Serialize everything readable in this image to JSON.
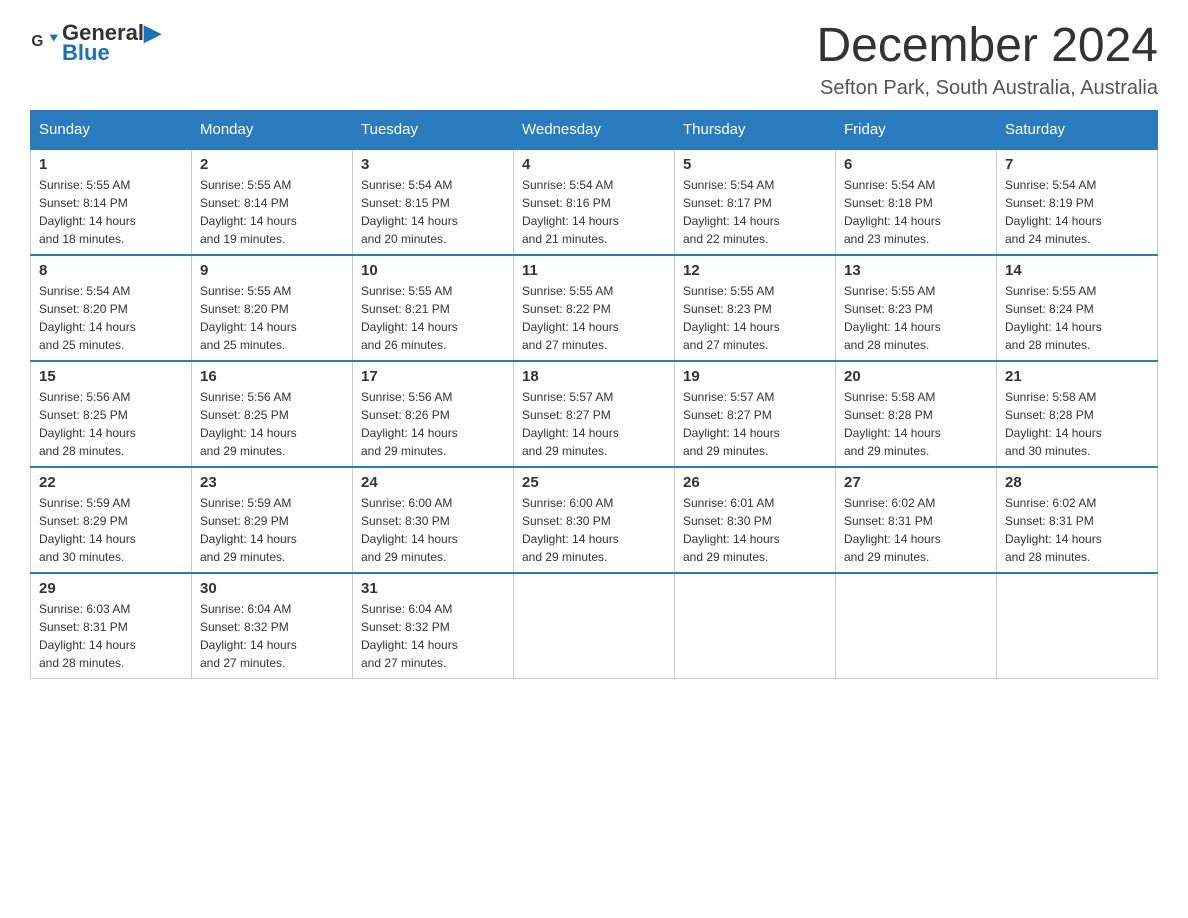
{
  "header": {
    "logo_general": "General",
    "logo_blue": "Blue",
    "month_title": "December 2024",
    "location": "Sefton Park, South Australia, Australia"
  },
  "days_of_week": [
    "Sunday",
    "Monday",
    "Tuesday",
    "Wednesday",
    "Thursday",
    "Friday",
    "Saturday"
  ],
  "weeks": [
    [
      {
        "day": "1",
        "sunrise": "5:55 AM",
        "sunset": "8:14 PM",
        "daylight": "14 hours and 18 minutes."
      },
      {
        "day": "2",
        "sunrise": "5:55 AM",
        "sunset": "8:14 PM",
        "daylight": "14 hours and 19 minutes."
      },
      {
        "day": "3",
        "sunrise": "5:54 AM",
        "sunset": "8:15 PM",
        "daylight": "14 hours and 20 minutes."
      },
      {
        "day": "4",
        "sunrise": "5:54 AM",
        "sunset": "8:16 PM",
        "daylight": "14 hours and 21 minutes."
      },
      {
        "day": "5",
        "sunrise": "5:54 AM",
        "sunset": "8:17 PM",
        "daylight": "14 hours and 22 minutes."
      },
      {
        "day": "6",
        "sunrise": "5:54 AM",
        "sunset": "8:18 PM",
        "daylight": "14 hours and 23 minutes."
      },
      {
        "day": "7",
        "sunrise": "5:54 AM",
        "sunset": "8:19 PM",
        "daylight": "14 hours and 24 minutes."
      }
    ],
    [
      {
        "day": "8",
        "sunrise": "5:54 AM",
        "sunset": "8:20 PM",
        "daylight": "14 hours and 25 minutes."
      },
      {
        "day": "9",
        "sunrise": "5:55 AM",
        "sunset": "8:20 PM",
        "daylight": "14 hours and 25 minutes."
      },
      {
        "day": "10",
        "sunrise": "5:55 AM",
        "sunset": "8:21 PM",
        "daylight": "14 hours and 26 minutes."
      },
      {
        "day": "11",
        "sunrise": "5:55 AM",
        "sunset": "8:22 PM",
        "daylight": "14 hours and 27 minutes."
      },
      {
        "day": "12",
        "sunrise": "5:55 AM",
        "sunset": "8:23 PM",
        "daylight": "14 hours and 27 minutes."
      },
      {
        "day": "13",
        "sunrise": "5:55 AM",
        "sunset": "8:23 PM",
        "daylight": "14 hours and 28 minutes."
      },
      {
        "day": "14",
        "sunrise": "5:55 AM",
        "sunset": "8:24 PM",
        "daylight": "14 hours and 28 minutes."
      }
    ],
    [
      {
        "day": "15",
        "sunrise": "5:56 AM",
        "sunset": "8:25 PM",
        "daylight": "14 hours and 28 minutes."
      },
      {
        "day": "16",
        "sunrise": "5:56 AM",
        "sunset": "8:25 PM",
        "daylight": "14 hours and 29 minutes."
      },
      {
        "day": "17",
        "sunrise": "5:56 AM",
        "sunset": "8:26 PM",
        "daylight": "14 hours and 29 minutes."
      },
      {
        "day": "18",
        "sunrise": "5:57 AM",
        "sunset": "8:27 PM",
        "daylight": "14 hours and 29 minutes."
      },
      {
        "day": "19",
        "sunrise": "5:57 AM",
        "sunset": "8:27 PM",
        "daylight": "14 hours and 29 minutes."
      },
      {
        "day": "20",
        "sunrise": "5:58 AM",
        "sunset": "8:28 PM",
        "daylight": "14 hours and 29 minutes."
      },
      {
        "day": "21",
        "sunrise": "5:58 AM",
        "sunset": "8:28 PM",
        "daylight": "14 hours and 30 minutes."
      }
    ],
    [
      {
        "day": "22",
        "sunrise": "5:59 AM",
        "sunset": "8:29 PM",
        "daylight": "14 hours and 30 minutes."
      },
      {
        "day": "23",
        "sunrise": "5:59 AM",
        "sunset": "8:29 PM",
        "daylight": "14 hours and 29 minutes."
      },
      {
        "day": "24",
        "sunrise": "6:00 AM",
        "sunset": "8:30 PM",
        "daylight": "14 hours and 29 minutes."
      },
      {
        "day": "25",
        "sunrise": "6:00 AM",
        "sunset": "8:30 PM",
        "daylight": "14 hours and 29 minutes."
      },
      {
        "day": "26",
        "sunrise": "6:01 AM",
        "sunset": "8:30 PM",
        "daylight": "14 hours and 29 minutes."
      },
      {
        "day": "27",
        "sunrise": "6:02 AM",
        "sunset": "8:31 PM",
        "daylight": "14 hours and 29 minutes."
      },
      {
        "day": "28",
        "sunrise": "6:02 AM",
        "sunset": "8:31 PM",
        "daylight": "14 hours and 28 minutes."
      }
    ],
    [
      {
        "day": "29",
        "sunrise": "6:03 AM",
        "sunset": "8:31 PM",
        "daylight": "14 hours and 28 minutes."
      },
      {
        "day": "30",
        "sunrise": "6:04 AM",
        "sunset": "8:32 PM",
        "daylight": "14 hours and 27 minutes."
      },
      {
        "day": "31",
        "sunrise": "6:04 AM",
        "sunset": "8:32 PM",
        "daylight": "14 hours and 27 minutes."
      },
      null,
      null,
      null,
      null
    ]
  ],
  "labels": {
    "sunrise": "Sunrise:",
    "sunset": "Sunset:",
    "daylight": "Daylight:"
  }
}
